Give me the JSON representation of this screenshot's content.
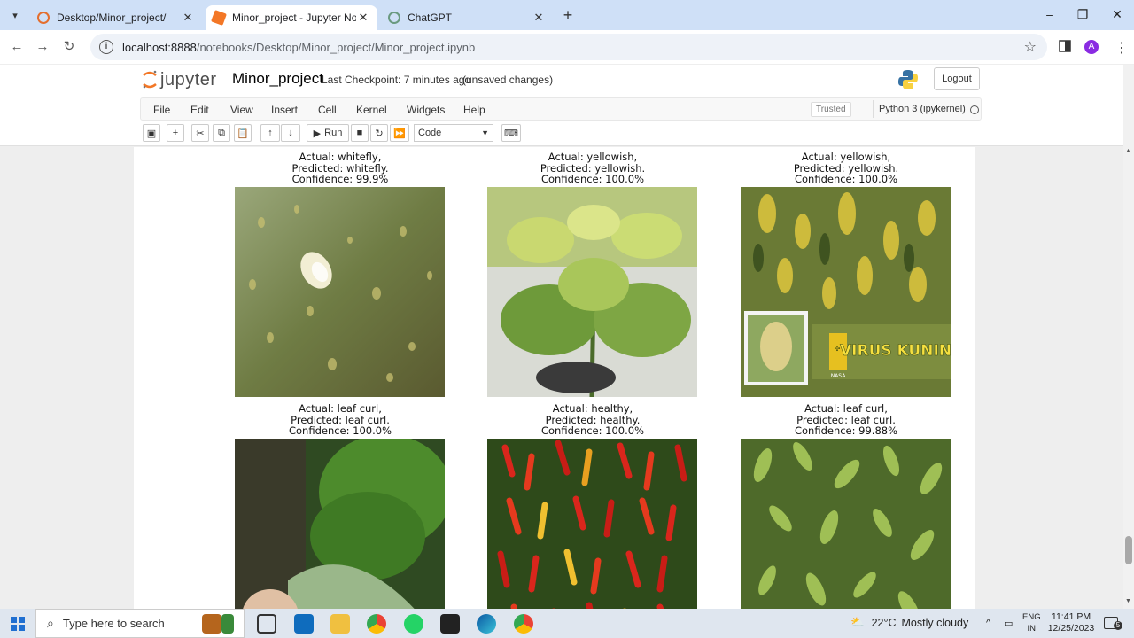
{
  "browser": {
    "tabs": [
      {
        "title": "Desktop/Minor_project/",
        "active": false
      },
      {
        "title": "Minor_project - Jupyter Notebo",
        "active": true
      },
      {
        "title": "ChatGPT",
        "active": false
      }
    ],
    "url_host": "localhost:8888",
    "url_path": "/notebooks/Desktop/Minor_project/Minor_project.ipynb",
    "profile_initial": "A"
  },
  "jupyter": {
    "logo_text": "jupyter",
    "notebook_name": "Minor_project",
    "checkpoint": "Last Checkpoint: 7 minutes ago",
    "unsaved": "(unsaved changes)",
    "logout_label": "Logout",
    "menu": [
      "File",
      "Edit",
      "View",
      "Insert",
      "Cell",
      "Kernel",
      "Widgets",
      "Help"
    ],
    "trusted_label": "Trusted",
    "kernel_name": "Python 3 (ipykernel)",
    "run_label": "Run",
    "cell_type": "Code"
  },
  "predictions": [
    {
      "actual": "Actual: whitefly,",
      "predicted": "Predicted: whitefly.",
      "confidence": "Confidence: 99.9%",
      "subject": "whitefly"
    },
    {
      "actual": "Actual: yellowish,",
      "predicted": "Predicted: yellowish.",
      "confidence": "Confidence: 100.0%",
      "subject": "yellowish"
    },
    {
      "actual": "Actual: yellowish,",
      "predicted": "Predicted: yellowish.",
      "confidence": "Confidence: 100.0%",
      "subject": "yellowish-virus"
    },
    {
      "actual": "Actual: leaf curl,",
      "predicted": "Predicted: leaf curl.",
      "confidence": "Confidence: 100.0%",
      "subject": "leaf-curl"
    },
    {
      "actual": "Actual: healthy,",
      "predicted": "Predicted: healthy.",
      "confidence": "Confidence: 100.0%",
      "subject": "healthy"
    },
    {
      "actual": "Actual: leaf curl,",
      "predicted": "Predicted: leaf curl.",
      "confidence": "Confidence: 99.88%",
      "subject": "leaf-curl-field"
    }
  ],
  "image_overlay": {
    "banner_text": "VIRUS KUNING",
    "logo_text": "NASA"
  },
  "taskbar": {
    "search_placeholder": "Type here to search",
    "weather_temp": "22°C",
    "weather_desc": "Mostly cloudy",
    "lang_line1": "ENG",
    "lang_line2": "IN",
    "time": "11:41 PM",
    "date": "12/25/2023",
    "notif_count": "5"
  }
}
